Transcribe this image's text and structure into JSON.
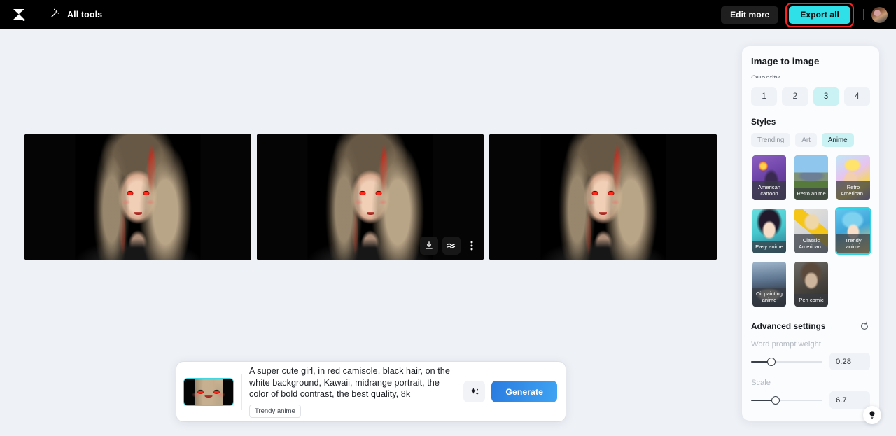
{
  "topbar": {
    "logo_icon": "capcut-logo-icon",
    "all_tools_icon": "magic-wand-icon",
    "all_tools_label": "All tools",
    "edit_more_label": "Edit more",
    "export_all_label": "Export all",
    "avatar_icon": "user-avatar",
    "export_highlight_color": "#ff2020",
    "export_button_color": "#30e0e8"
  },
  "canvas": {
    "results": [
      {
        "name": "result-image-1",
        "alt": "anime portrait with red eyes 1"
      },
      {
        "name": "result-image-2",
        "alt": "anime portrait with red eyes 2"
      },
      {
        "name": "result-image-3",
        "alt": "anime portrait with red eyes 3"
      }
    ],
    "image_toolbar": {
      "download_icon": "download-icon",
      "enhance_icon": "wave-enhance-icon",
      "more_icon": "more-vertical-icon"
    }
  },
  "prompt_bar": {
    "thumbnail_icon": "reference-image-thumbnail",
    "text": "A super cute girl, in red camisole, black hair, on the white background, Kawaii, midrange portrait,  the color of bold contrast, the best quality, 8k",
    "tag": "Trendy anime",
    "magic_icon": "sparkle-icon",
    "generate_label": "Generate"
  },
  "panel": {
    "title": "Image to image",
    "cut_off_label": "Quantity",
    "quantity": {
      "options": [
        "1",
        "2",
        "3",
        "4"
      ],
      "selected": "3"
    },
    "styles": {
      "section_label": "Styles",
      "filters": [
        {
          "label": "Trending",
          "active": false
        },
        {
          "label": "Art",
          "active": false
        },
        {
          "label": "Anime",
          "active": true
        }
      ],
      "cards": [
        {
          "label": "American cartoon",
          "art": "art-american-cartoon",
          "selected": false
        },
        {
          "label": "Retro anime",
          "art": "art-retro-anime",
          "selected": false
        },
        {
          "label": "Retro American..",
          "art": "art-retro-american",
          "selected": false
        },
        {
          "label": "Easy anime",
          "art": "art-easy-anime",
          "selected": false
        },
        {
          "label": "Classic American..",
          "art": "art-classic-american",
          "selected": false
        },
        {
          "label": "Trendy anime",
          "art": "art-trendy-anime",
          "selected": true
        },
        {
          "label": "Oil painting anime",
          "art": "art-oil-painting",
          "selected": false
        },
        {
          "label": "Pen comic",
          "art": "art-pen-comic",
          "selected": false
        }
      ]
    },
    "advanced": {
      "title": "Advanced settings",
      "reset_icon": "reset-icon",
      "settings": [
        {
          "label": "Word prompt weight",
          "value": "0.28",
          "percent": 28
        },
        {
          "label": "Scale",
          "value": "6.7",
          "percent": 34
        }
      ]
    }
  },
  "help": {
    "icon": "lightbulb-icon"
  }
}
